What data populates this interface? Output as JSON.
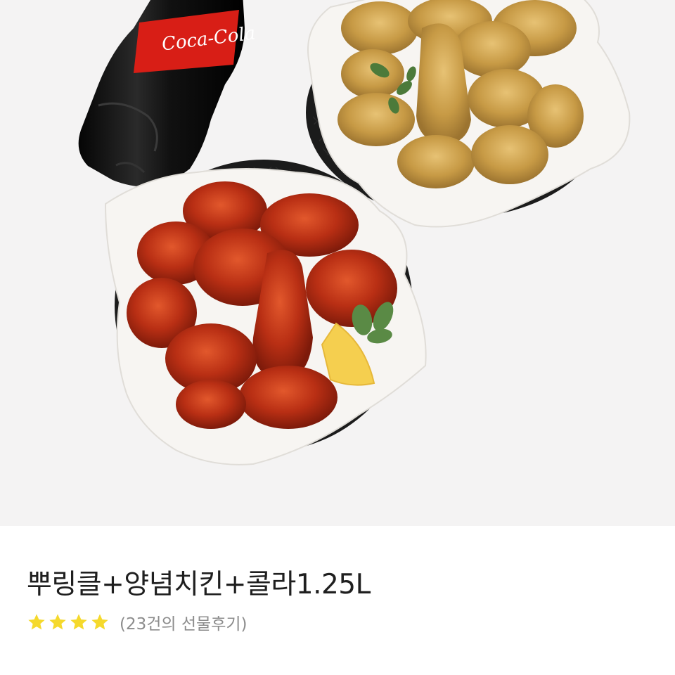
{
  "product": {
    "image_alt": "Chicken set with cola",
    "title": "뿌링클+양념치킨+콜라1.25L",
    "rating": {
      "stars": 4,
      "max_stars": 4,
      "star_color": "#f5d92c",
      "review_text": "(23건의 선물후기)"
    }
  },
  "images": {
    "bottle_label_brand": "Coca-Cola"
  },
  "colors": {
    "hero_background": "#f4f3f3",
    "title_text": "#1f1f1f",
    "review_text": "#8c8c8c"
  }
}
